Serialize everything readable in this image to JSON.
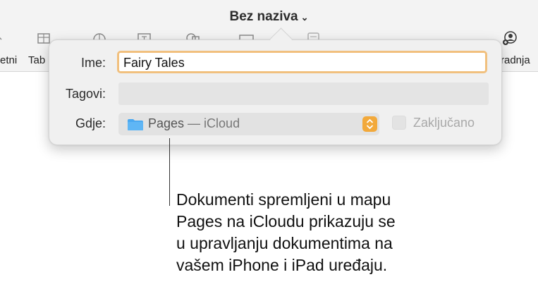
{
  "toolbar": {
    "title": "Bez naziva",
    "left_label_1": "etni",
    "left_label_2": "Tab",
    "right_label": "radnja"
  },
  "dialog": {
    "name_label": "Ime:",
    "name_value": "Fairy Tales",
    "tags_label": "Tagovi:",
    "tags_value": "",
    "where_label": "Gdje:",
    "where_folder": "Pages",
    "where_location": " — iCloud",
    "lock_label": "Zaključano",
    "lock_checked": false
  },
  "callout": {
    "lines": [
      "Dokumenti spremljeni u mapu",
      "Pages na iCloudu prikazuju se",
      "u upravljanju dokumentima na",
      "vašem iPhone i iPad uređaju."
    ]
  },
  "colors": {
    "accent": "#f2a93b",
    "focus_ring": "#f1c07e",
    "folder": "#4aa8f0"
  }
}
